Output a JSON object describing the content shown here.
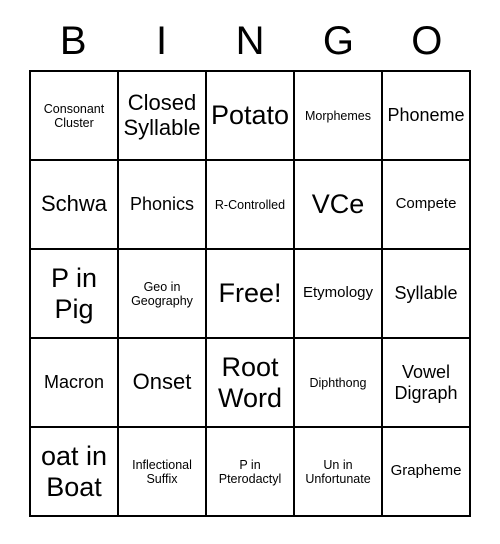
{
  "card": {
    "header_letters": [
      "B",
      "I",
      "N",
      "G",
      "O"
    ],
    "rows": [
      [
        {
          "text": "Consonant Cluster",
          "size": "xs"
        },
        {
          "text": "Closed Syllable",
          "size": "l"
        },
        {
          "text": "Potato",
          "size": "xl"
        },
        {
          "text": "Morphemes",
          "size": "xs"
        },
        {
          "text": "Phoneme",
          "size": "m"
        }
      ],
      [
        {
          "text": "Schwa",
          "size": "l"
        },
        {
          "text": "Phonics",
          "size": "m"
        },
        {
          "text": "R-Controlled",
          "size": "xs"
        },
        {
          "text": "VCe",
          "size": "xl"
        },
        {
          "text": "Compete",
          "size": "s"
        }
      ],
      [
        {
          "text": "P in Pig",
          "size": "xl"
        },
        {
          "text": "Geo in Geography",
          "size": "xs"
        },
        {
          "text": "Free!",
          "size": "xl"
        },
        {
          "text": "Etymology",
          "size": "s"
        },
        {
          "text": "Syllable",
          "size": "m"
        }
      ],
      [
        {
          "text": "Macron",
          "size": "m"
        },
        {
          "text": "Onset",
          "size": "l"
        },
        {
          "text": "Root Word",
          "size": "xl"
        },
        {
          "text": "Diphthong",
          "size": "xs"
        },
        {
          "text": "Vowel Digraph",
          "size": "m"
        }
      ],
      [
        {
          "text": "oat in Boat",
          "size": "xl"
        },
        {
          "text": "Inflectional Suffix",
          "size": "xs"
        },
        {
          "text": "P in Pterodactyl",
          "size": "xs"
        },
        {
          "text": "Un in Unfortunate",
          "size": "xs"
        },
        {
          "text": "Grapheme",
          "size": "s"
        }
      ]
    ],
    "colors": {
      "background": "#ffffff",
      "text": "#000000",
      "grid_line": "#000000"
    }
  }
}
